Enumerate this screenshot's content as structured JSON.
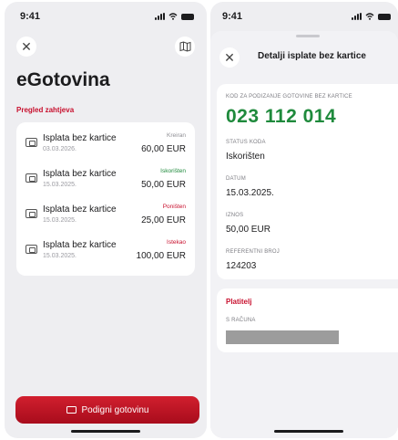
{
  "left_screen": {
    "status_time": "9:41",
    "title": "eGotovina",
    "section_label": "Pregled zahtjeva",
    "requests": [
      {
        "name": "Isplata bez kartice",
        "date": "03.03.2026.",
        "status": "Kreiran",
        "status_color": "#8e8e93",
        "amount": "60,00 EUR"
      },
      {
        "name": "Isplata bez kartice",
        "date": "15.03.2025.",
        "status": "Iskorišten",
        "status_color": "#1f8a3c",
        "amount": "50,00 EUR"
      },
      {
        "name": "Isplata bez kartice",
        "date": "15.03.2025.",
        "status": "Poništen",
        "status_color": "#c8102e",
        "amount": "25,00 EUR"
      },
      {
        "name": "Isplata bez kartice",
        "date": "15.03.2025.",
        "status": "Istekao",
        "status_color": "#c8102e",
        "amount": "100,00 EUR"
      }
    ],
    "cta_label": "Podigni gotovinu"
  },
  "right_screen": {
    "status_time": "9:41",
    "sheet_title": "Detalji isplate bez kartice",
    "code_label": "KOD ZA PODIZANJE GOTOVINE BEZ KARTICE",
    "code_value": "023 112 014",
    "fields": [
      {
        "label": "STATUS KODA",
        "value": "Iskorišten"
      },
      {
        "label": "DATUM",
        "value": "15.03.2025."
      },
      {
        "label": "IZNOS",
        "value": "50,00 EUR"
      },
      {
        "label": "REFERENTNI BROJ",
        "value": "124203"
      }
    ],
    "payer_title": "Platitelj",
    "account_label": "S RAČUNA"
  },
  "colors": {
    "brand_red": "#c8102e",
    "success_green": "#1f8a3c",
    "background": "#eeeef1"
  },
  "icons": [
    "close-icon",
    "map-icon",
    "cash-icon",
    "signal-icon",
    "wifi-icon",
    "battery-icon"
  ]
}
